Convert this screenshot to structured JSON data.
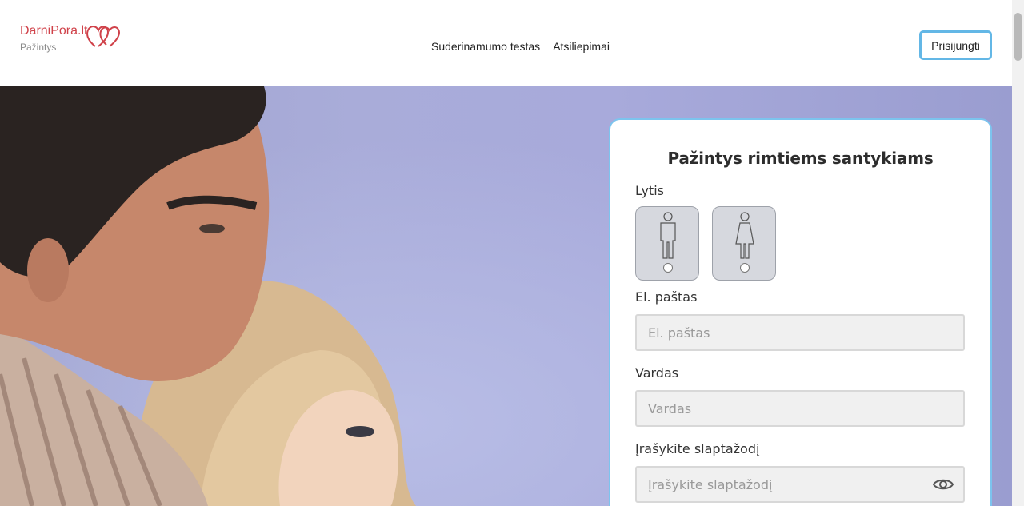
{
  "header": {
    "logo_text": "DarniPora.lt",
    "logo_sub": "Pažintys",
    "nav": [
      "Suderinamumo testas",
      "Atsiliepimai"
    ],
    "login_label": "Prisijungti"
  },
  "form": {
    "title": "Pažintys rimtiems santykiams",
    "gender_label": "Lytis",
    "gender_options": [
      "male-icon",
      "female-icon"
    ],
    "email_label": "El. paštas",
    "email_placeholder": "El. paštas",
    "name_label": "Vardas",
    "name_placeholder": "Vardas",
    "password_label": "Įrašykite slaptažodį",
    "password_placeholder": "Įrašykite slaptažodį"
  },
  "colors": {
    "brand": "#d0424a",
    "accent": "#63b7e6"
  }
}
